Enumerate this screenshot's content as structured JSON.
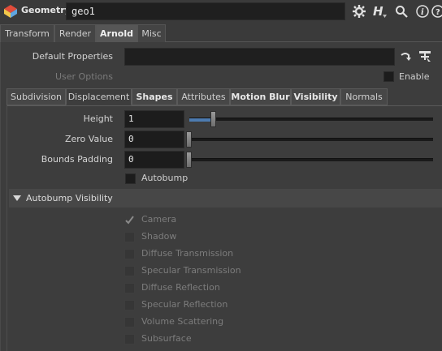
{
  "header": {
    "node_type": "Geometry",
    "node_name": "geo1",
    "icons": [
      "gear-icon",
      "houdini-help-icon",
      "search-icon",
      "info-icon",
      "question-icon"
    ]
  },
  "top_tabs": [
    {
      "label": "Transform",
      "active": false
    },
    {
      "label": "Render",
      "active": false
    },
    {
      "label": "Arnold",
      "active": true
    },
    {
      "label": "Misc",
      "active": false
    }
  ],
  "default_properties": {
    "label": "Default Properties",
    "value": ""
  },
  "user_options": {
    "label": "User Options",
    "enable_label": "Enable"
  },
  "sub_tabs": [
    {
      "label": "Subdivision"
    },
    {
      "label": "Displacement",
      "active": true
    },
    {
      "label": "Shapes"
    },
    {
      "label": "Attributes"
    },
    {
      "label": "Motion Blur"
    },
    {
      "label": "Visibility"
    },
    {
      "label": "Normals"
    }
  ],
  "params": {
    "height": {
      "label": "Height",
      "value": "1",
      "slider_fraction": 0.1
    },
    "zero_value": {
      "label": "Zero Value",
      "value": "0",
      "slider_fraction": 0.0
    },
    "bounds_padding": {
      "label": "Bounds Padding",
      "value": "0",
      "slider_fraction": 0.0
    },
    "autobump": {
      "label": "Autobump",
      "checked": false
    }
  },
  "autobump_visibility": {
    "title": "Autobump Visibility",
    "items": [
      {
        "label": "Camera",
        "checked": true
      },
      {
        "label": "Shadow",
        "checked": false
      },
      {
        "label": "Diffuse Transmission",
        "checked": false
      },
      {
        "label": "Specular Transmission",
        "checked": false
      },
      {
        "label": "Diffuse Reflection",
        "checked": false
      },
      {
        "label": "Specular Reflection",
        "checked": false
      },
      {
        "label": "Volume Scattering",
        "checked": false
      },
      {
        "label": "Subsurface",
        "checked": false
      }
    ]
  },
  "colors": {
    "slider_fill": "#4d7bb0",
    "background": "#3a3a3a"
  }
}
